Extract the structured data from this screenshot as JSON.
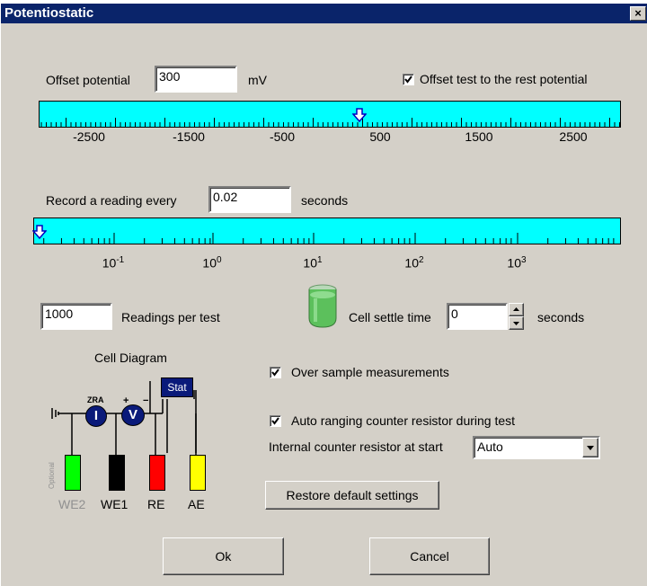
{
  "window": {
    "title": "Potentiostatic",
    "close_glyph": "×"
  },
  "offset": {
    "label": "Offset potential",
    "value": "300",
    "unit": "mV",
    "rest_checkbox_label": "Offset test to the rest potential",
    "rest_checked": true,
    "scale_labels": [
      "-2500",
      "-1500",
      "-500",
      "500",
      "1500",
      "2500"
    ]
  },
  "record": {
    "label": "Record a reading every",
    "value": "0.02",
    "unit": "seconds",
    "scale_bases": [
      "10",
      "10",
      "10",
      "10",
      "10"
    ],
    "scale_exponents": [
      "-1",
      "0",
      "1",
      "2",
      "3"
    ]
  },
  "readings": {
    "value": "1000",
    "label": "Readings per test"
  },
  "settle": {
    "label": "Cell settle time",
    "value": "0",
    "unit": "seconds"
  },
  "cell_diagram": {
    "title": "Cell Diagram",
    "stat_label": "Stat",
    "zra_label": "ZRA",
    "current_symbol": "I",
    "voltage_symbol": "V",
    "plus": "+",
    "minus": "−",
    "optional_label": "Optional",
    "electrodes": [
      "WE2",
      "WE1",
      "RE",
      "AE"
    ],
    "electrode_colors": [
      "#00ff00",
      "#000000",
      "#ff0000",
      "#ffff00"
    ]
  },
  "options": {
    "oversample_label": "Over sample measurements",
    "oversample_checked": true,
    "autorange_label": "Auto ranging counter resistor during test",
    "autorange_checked": true,
    "counter_resistor_label": "Internal counter resistor at start",
    "counter_resistor_value": "Auto"
  },
  "buttons": {
    "restore": "Restore default settings",
    "ok": "Ok",
    "cancel": "Cancel"
  },
  "colors": {
    "title_bar": "#0a246a",
    "ruler": "#00ffff",
    "dialog_bg": "#d4d0c8"
  }
}
